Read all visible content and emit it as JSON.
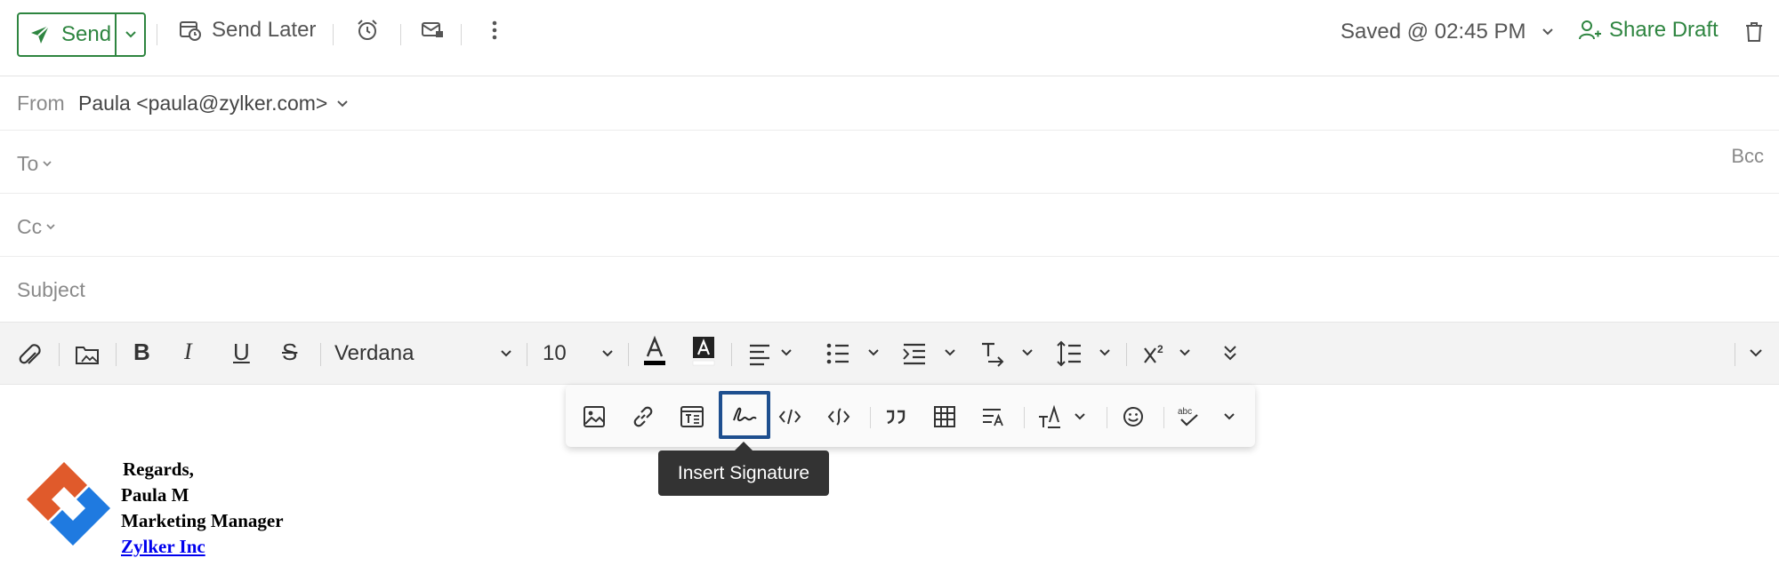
{
  "toolbar": {
    "send_label": "Send",
    "send_later_label": "Send Later",
    "saved_label": "Saved @ 02:45 PM",
    "share_draft_label": "Share Draft"
  },
  "header": {
    "from_label": "From",
    "from_value": "Paula <paula@zylker.com>",
    "to_label": "To",
    "cc_label": "Cc",
    "bcc_label": "Bcc",
    "subject_placeholder": "Subject"
  },
  "format": {
    "font_family": "Verdana",
    "font_size": "10"
  },
  "tooltip": {
    "text": "Insert Signature"
  },
  "signature": {
    "line1": "Regards,",
    "line2": "Paula M",
    "line3": "Marketing Manager",
    "link": "Zylker Inc"
  },
  "colors": {
    "accent_green": "#2e8540",
    "highlight_blue": "#1e4f8f",
    "logo_orange": "#e05a2b",
    "logo_blue": "#1f7ae0"
  }
}
